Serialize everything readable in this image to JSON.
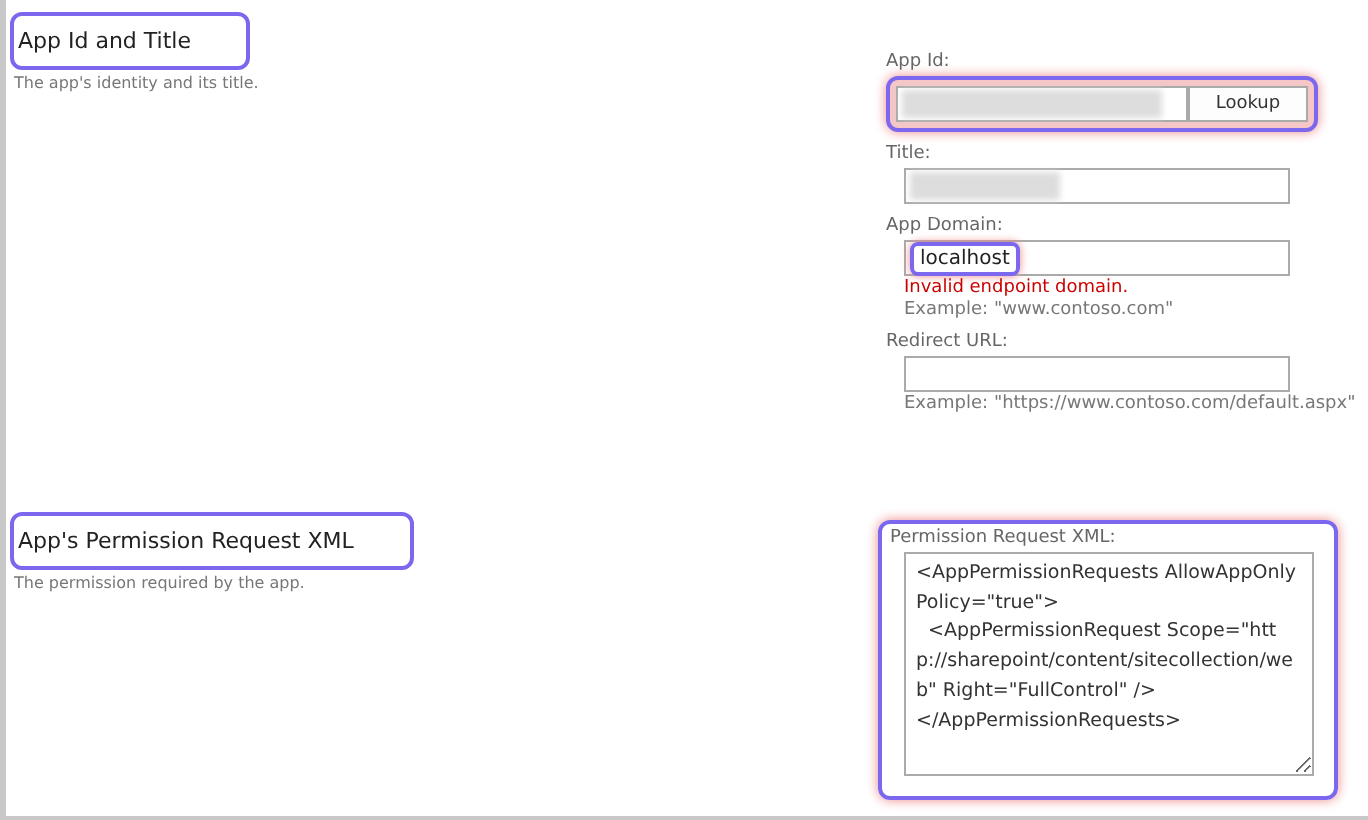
{
  "sections": [
    {
      "title": "App Id and Title",
      "description": "The app's identity and its title.",
      "highlighted": true,
      "fields": [
        {
          "kind": "lookup",
          "label": "App Id:",
          "redacted": true,
          "button": "Lookup",
          "highlighted": true
        },
        {
          "kind": "text",
          "label": "Title:",
          "redacted": true
        },
        {
          "kind": "text",
          "label": "App Domain:",
          "value": "localhost",
          "value_highlighted": true,
          "error": "Invalid endpoint domain.",
          "example": "Example: \"www.contoso.com\""
        },
        {
          "kind": "text",
          "label": "Redirect URL:",
          "example": "Example: \"https://www.contoso.com/default.aspx\""
        }
      ]
    },
    {
      "title": "App's Permission Request XML",
      "description": "The permission required by the app.",
      "highlighted": true,
      "fields": [
        {
          "kind": "textarea",
          "label": "Permission Request XML:",
          "highlighted": true,
          "value": "<AppPermissionRequests AllowAppOnlyPolicy=\"true\">\n  <AppPermissionRequest Scope=\"http://sharepoint/content/sitecollection/web\" Right=\"FullControl\" />\n</AppPermissionRequests>"
        }
      ]
    }
  ]
}
